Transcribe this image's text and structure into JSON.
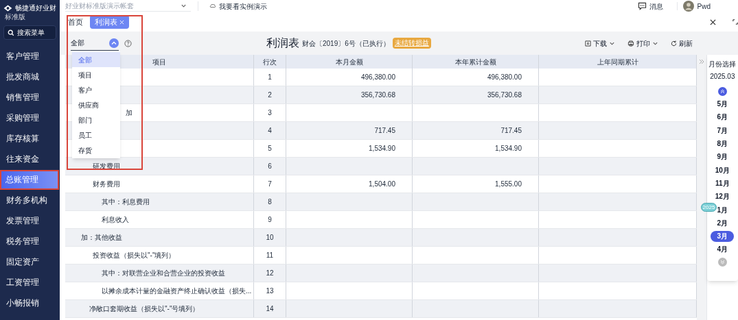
{
  "sidebar": {
    "logo": {
      "name": "畅捷通好业财",
      "edition": "标准版"
    },
    "search": "搜索菜单",
    "items": [
      {
        "label": "客户管理",
        "selected": false
      },
      {
        "label": "批发商城",
        "selected": false
      },
      {
        "label": "销售管理",
        "selected": false
      },
      {
        "label": "采购管理",
        "selected": false
      },
      {
        "label": "库存核算",
        "selected": false
      },
      {
        "label": "往来资金",
        "selected": false
      },
      {
        "label": "总账管理",
        "selected": true,
        "outlined": true
      },
      {
        "label": "财务多机构",
        "selected": false
      },
      {
        "label": "发票管理",
        "selected": false
      },
      {
        "label": "税务管理",
        "selected": false
      },
      {
        "label": "固定资产",
        "selected": false
      },
      {
        "label": "工资管理",
        "selected": false
      },
      {
        "label": "小畅报销",
        "selected": false
      }
    ]
  },
  "topbar": {
    "account": {
      "placeholder": "好业财标准版演示帐套"
    },
    "demo_link": "我要看实例演示",
    "messages": "消息",
    "user": "Pwd"
  },
  "tabs": [
    {
      "label": "首页",
      "selected": false,
      "closable": false
    },
    {
      "label": "利润表",
      "selected": true,
      "closable": true
    }
  ],
  "toolbar": {
    "filter": {
      "value": "全部",
      "expanded": true
    },
    "title": "利润表",
    "standard": "财会〔2019〕6号（已执行）",
    "status_tag": "未结转损益",
    "actions": [
      {
        "label": "下载",
        "kind": "download"
      },
      {
        "label": "打印",
        "kind": "print"
      },
      {
        "label": "刷新",
        "kind": "refresh"
      }
    ]
  },
  "dropdown": {
    "outlined": true,
    "options": [
      {
        "label": "全部",
        "selected": true
      },
      {
        "label": "项目",
        "selected": false
      },
      {
        "label": "客户",
        "selected": false
      },
      {
        "label": "供应商",
        "selected": false
      },
      {
        "label": "部门",
        "selected": false
      },
      {
        "label": "员工",
        "selected": false
      },
      {
        "label": "存货",
        "selected": false
      }
    ]
  },
  "table": {
    "columns": [
      "项目",
      "行次",
      "本月金额",
      "本年累计金额",
      "上年同期累计"
    ],
    "rows": [
      {
        "kind": "covered",
        "line": "1",
        "month": "496,380.00",
        "year": "496,380.00"
      },
      {
        "kind": "covered",
        "line": "2",
        "month": "356,730.68",
        "year": "356,730.68"
      },
      {
        "kind": "covered",
        "item": "加",
        "line": "3"
      },
      {
        "kind": "covered",
        "line": "4",
        "month": "717.45",
        "year": "717.45"
      },
      {
        "kind": "covered",
        "line": "5",
        "month": "1,534.90",
        "year": "1,534.90"
      },
      {
        "kind": "item",
        "item": "研发费用",
        "line": "6"
      },
      {
        "kind": "item",
        "item": "财务费用",
        "line": "7",
        "month": "1,504.00",
        "year": "1,555.00"
      },
      {
        "kind": "sub",
        "item": "其中：利息费用",
        "line": "8"
      },
      {
        "kind": "sub",
        "item": "利息收入",
        "line": "9"
      },
      {
        "kind": "top",
        "item": "加：其他收益",
        "line": "10"
      },
      {
        "kind": "item",
        "item": "投资收益（损失以\"-\"填列）",
        "line": "11"
      },
      {
        "kind": "sub",
        "item": "其中：对联营企业和合营企业的投资收益",
        "line": "12"
      },
      {
        "kind": "sub",
        "item": "以摊余成本计量的金融资产终止确认收益（损失...",
        "line": "13"
      },
      {
        "kind": "mid",
        "item": "净敞口套期收益（损失以\"-\"号填列）",
        "line": "14"
      }
    ]
  },
  "month_panel": {
    "title": "月份选择",
    "value": "2025.03",
    "months": [
      {
        "label": "5月",
        "selected": false
      },
      {
        "label": "6月",
        "selected": false
      },
      {
        "label": "7月",
        "selected": false
      },
      {
        "label": "8月",
        "selected": false
      },
      {
        "label": "9月",
        "selected": false
      },
      {
        "label": "10月",
        "selected": false
      },
      {
        "label": "11月",
        "selected": false
      },
      {
        "label": "12月",
        "selected": false
      },
      {
        "label": "1月",
        "selected": false,
        "year_badge": "2025"
      },
      {
        "label": "2月",
        "selected": false
      },
      {
        "label": "3月",
        "selected": true
      },
      {
        "label": "4月",
        "selected": false
      }
    ]
  }
}
